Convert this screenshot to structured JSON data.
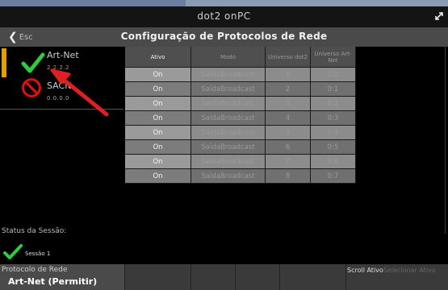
{
  "app": {
    "title": "dot2 onPC"
  },
  "header": {
    "esc_label": "Esc",
    "title": "Configuração de Protocolos de Rede"
  },
  "protocols": [
    {
      "name": "Art-Net",
      "ip": "2.2.2.2",
      "icon": "check-icon",
      "selected": true
    },
    {
      "name": "SACN",
      "ip": "0.0.0.0",
      "icon": "prohibited-icon",
      "selected": false
    }
  ],
  "table": {
    "headers": {
      "ativo": "Ativo",
      "modo": "Modo",
      "universo_dot2": "Universo dot2",
      "universo_artnet": "Universo Art-Net"
    },
    "rows": [
      {
        "ativo": "On",
        "modo": "SaídaBroadcast",
        "universo_dot2": "1",
        "universo_artnet": "0:0"
      },
      {
        "ativo": "On",
        "modo": "SaídaBroadcast",
        "universo_dot2": "2",
        "universo_artnet": "0:1"
      },
      {
        "ativo": "On",
        "modo": "SaídaBroadcast",
        "universo_dot2": "3",
        "universo_artnet": "0:2"
      },
      {
        "ativo": "On",
        "modo": "SaídaBroadcast",
        "universo_dot2": "4",
        "universo_artnet": "0:3"
      },
      {
        "ativo": "On",
        "modo": "SaídaBroadcast",
        "universo_dot2": "5",
        "universo_artnet": "0:4"
      },
      {
        "ativo": "On",
        "modo": "SaídaBroadcast",
        "universo_dot2": "6",
        "universo_artnet": "0:5"
      },
      {
        "ativo": "On",
        "modo": "SaídaBroadcast",
        "universo_dot2": "7",
        "universo_artnet": "0:6"
      },
      {
        "ativo": "On",
        "modo": "SaídaBroadcast",
        "universo_dot2": "8",
        "universo_artnet": "0:7"
      }
    ]
  },
  "session": {
    "status_label": "Status da Sessão:",
    "name": "Sessão 1"
  },
  "bottombar": {
    "protocol_title": "Protocolo de Rede",
    "protocol_value": "Art-Net (Permitir)",
    "scroll_label": "Scroll Ativo",
    "scroll_rest": "Selecionar Ativo"
  },
  "colors": {
    "accent": "#e8a000",
    "check": "#2ecc40",
    "prohibited": "#e01010",
    "annotation_arrow": "#e02020"
  }
}
